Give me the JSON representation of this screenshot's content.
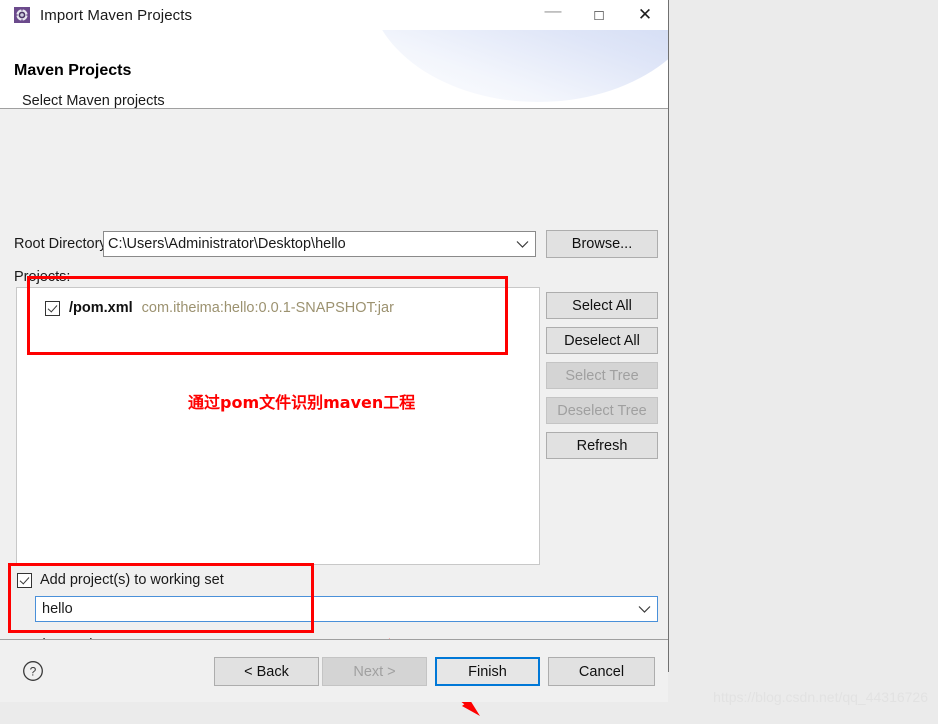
{
  "window": {
    "title": "Import Maven Projects",
    "icon": "maven-gear-icon",
    "minimize": "—",
    "maximize": "□",
    "close": "✕"
  },
  "header": {
    "title": "Maven Projects",
    "subtitle": "Select Maven projects"
  },
  "root_directory": {
    "label": "Root Directory:",
    "value": "C:\\Users\\Administrator\\Desktop\\hello",
    "placeholder": "",
    "browse_label": "Browse..."
  },
  "projects": {
    "label": "Projects:",
    "items": [
      {
        "checked": true,
        "name": "/pom.xml",
        "coordinates": "com.itheima:hello:0.0.1-SNAPSHOT:jar"
      }
    ],
    "buttons": [
      {
        "label": "Select All",
        "enabled": true
      },
      {
        "label": "Deselect All",
        "enabled": true
      },
      {
        "label": "Select Tree",
        "enabled": false
      },
      {
        "label": "Deselect Tree",
        "enabled": false
      },
      {
        "label": "Refresh",
        "enabled": true
      }
    ]
  },
  "working_set": {
    "checkbox_label": "Add project(s) to working set",
    "checked": true,
    "value": "hello"
  },
  "advanced": {
    "label": "Advanced",
    "expanded": false
  },
  "footer": {
    "help_icon": "question-mark-icon",
    "buttons": [
      {
        "label": "< Back",
        "enabled": true,
        "default": false
      },
      {
        "label": "Next >",
        "enabled": false,
        "default": false
      },
      {
        "label": "Finish",
        "enabled": true,
        "default": true
      },
      {
        "label": "Cancel",
        "enabled": true,
        "default": false
      }
    ]
  },
  "annotations": {
    "note_text": "通过pom文件识别maven工程",
    "color": "#fe0000"
  },
  "watermark": {
    "text": "https://blog.csdn.net/qq_44316726"
  }
}
